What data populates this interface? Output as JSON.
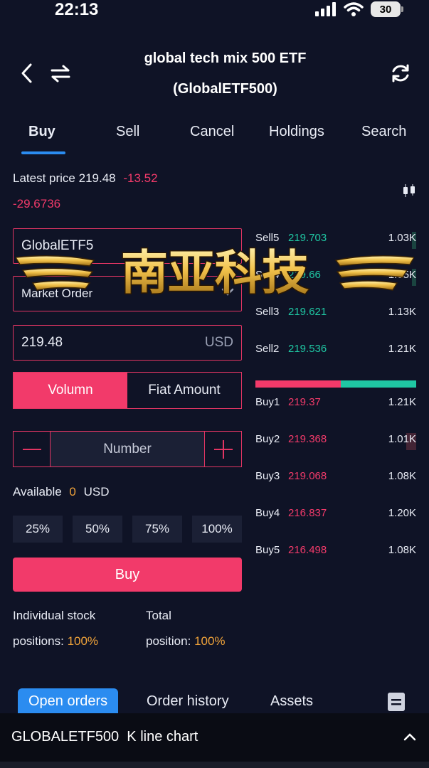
{
  "status": {
    "time": "22:13",
    "battery": "30"
  },
  "header": {
    "title_line1": "global tech mix 500 ETF",
    "title_line2": "(GlobalETF500)"
  },
  "tabs": [
    {
      "label": "Buy"
    },
    {
      "label": "Sell"
    },
    {
      "label": "Cancel"
    },
    {
      "label": "Holdings"
    },
    {
      "label": "Search"
    }
  ],
  "quote": {
    "prefix": "Latest price",
    "price": "219.48",
    "change": "-13.52",
    "change_pct": "-29.6736"
  },
  "form": {
    "symbol": "GlobalETF5",
    "order_type": "Market Order",
    "price_value": "219.48",
    "price_unit": "USD",
    "mode_volume": "Volumn",
    "mode_fiat": "Fiat Amount",
    "number_placeholder": "Number",
    "available_label": "Available",
    "available_value": "0",
    "available_unit": "USD",
    "percents": [
      "25%",
      "50%",
      "75%",
      "100%"
    ],
    "buy_label": "Buy"
  },
  "positions": {
    "individual_line1": "Individual stock",
    "individual_line2": "positions:",
    "individual_value": "100%",
    "total_line1": "Total",
    "total_line2": "position:",
    "total_value": "100%"
  },
  "orderbook": {
    "sells": [
      {
        "label": "Sell5",
        "price": "219.703",
        "qty": "1.03K"
      },
      {
        "label": "Sell4",
        "price": "219.66",
        "qty": "1.05K"
      },
      {
        "label": "Sell3",
        "price": "219.621",
        "qty": "1.13K"
      },
      {
        "label": "Sell2",
        "price": "219.536",
        "qty": "1.21K"
      }
    ],
    "buys": [
      {
        "label": "Buy1",
        "price": "219.37",
        "qty": "1.21K"
      },
      {
        "label": "Buy2",
        "price": "219.368",
        "qty": "1.01K"
      },
      {
        "label": "Buy3",
        "price": "219.068",
        "qty": "1.08K"
      },
      {
        "label": "Buy4",
        "price": "216.837",
        "qty": "1.20K"
      },
      {
        "label": "Buy5",
        "price": "216.498",
        "qty": "1.08K"
      }
    ],
    "buy_ratio": 0.53
  },
  "bottom_tabs": [
    {
      "label": "Open orders"
    },
    {
      "label": "Order history"
    },
    {
      "label": "Assets"
    }
  ],
  "kline": {
    "label": "GLOBALETF500  K line chart"
  },
  "watermark": {
    "text": "南亚科技"
  },
  "colors": {
    "accent_red": "#f23a6a",
    "accent_green": "#1fc7a3",
    "accent_blue": "#2b8cf0",
    "orange": "#f0a33a",
    "background": "#0f1326"
  }
}
